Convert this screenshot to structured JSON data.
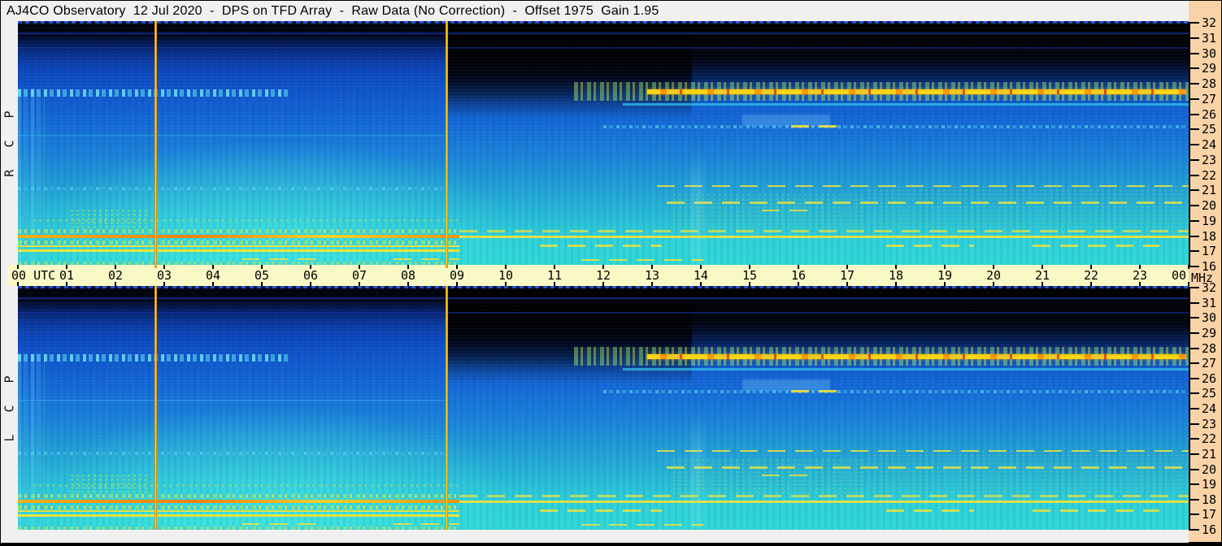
{
  "window": {
    "title": "AJ4CO Observatory  12 Jul 2020  -  DPS on TFD Array  -  Raw Data (No Correction)  -  Offset 1975  Gain 1.95"
  },
  "palette": {
    "titlebar_bg": "#f0f0f0",
    "time_axis_bg": "#f9f9c6",
    "freq_axis_bg": "#f9d3a7",
    "gutter_bg": "#f0f0f0",
    "border": "#000000",
    "calibration_line": "#ffd818",
    "calibration_line_edge": "#c05a08",
    "spectrogram_low": "#000104",
    "spectrogram_mid": "#1464d4",
    "spectrogram_high": "#2fd8da",
    "rfi_line": "#f0e23c",
    "emission_band_core": "#ffd414"
  },
  "chart_data": {
    "type": "heatmap",
    "subtype": "radio-spectrogram-dynamic-spectrum",
    "observatory": "AJ4CO Observatory",
    "date": "12 Jul 2020",
    "instrument": "DPS on TFD Array",
    "processing": "Raw Data (No Correction)",
    "offset": 1975,
    "gain": 1.95,
    "panels": [
      {
        "id": "rcp",
        "label": "R C P"
      },
      {
        "id": "lcp",
        "label": "L C P"
      }
    ],
    "time_axis": {
      "start_label": "00 UTC",
      "hour_labels": [
        "01",
        "02",
        "03",
        "04",
        "05",
        "06",
        "07",
        "08",
        "09",
        "10",
        "11",
        "12",
        "13",
        "14",
        "15",
        "16",
        "17",
        "18",
        "19",
        "20",
        "21",
        "22",
        "23"
      ],
      "end_label": "00",
      "hours_start": 0,
      "hours_end": 24
    },
    "freq_axis": {
      "unit": "MHz",
      "min": 16,
      "max": 32,
      "labels": [
        "32",
        "31",
        "30",
        "29",
        "28",
        "27",
        "26",
        "25",
        "24",
        "23",
        "22",
        "21",
        "20",
        "19",
        "18",
        "17",
        "16"
      ]
    },
    "features": [
      {
        "pattern": "vline",
        "h": 2.82,
        "note": "calibration line"
      },
      {
        "pattern": "vline",
        "h": 8.78,
        "note": "calibration line"
      },
      {
        "pattern": "line-blue-speckle",
        "h0": 0,
        "h1": 24,
        "f0": 31.98,
        "f1": 31.82,
        "opacity": 0.9
      },
      {
        "pattern": "line-blue-faint",
        "h0": 0,
        "h1": 24,
        "f0": 31.25,
        "f1": 31.15,
        "opacity": 0.7
      },
      {
        "pattern": "line-blue-faint",
        "h0": 0,
        "h1": 24,
        "f0": 30.3,
        "f1": 30.2,
        "opacity": 0.5
      },
      {
        "pattern": "speckle-cyan",
        "h0": 0,
        "h1": 0.55,
        "f0": 27.6,
        "f1": 16.1,
        "opacity": 0.28
      },
      {
        "pattern": "speckle-cyan",
        "h0": 0,
        "h1": 5.6,
        "f0": 27.5,
        "f1": 27.05,
        "opacity": 0.85
      },
      {
        "pattern": "speckle-green",
        "h0": 11.4,
        "h1": 24,
        "f0": 28.0,
        "f1": 26.8,
        "opacity": 0.55
      },
      {
        "pattern": "core-orange",
        "h0": 12.9,
        "h1": 23.95,
        "f0": 27.5,
        "f1": 27.2,
        "opacity": 1
      },
      {
        "pattern": "line-cyan",
        "h0": 12.4,
        "h1": 24,
        "f0": 26.6,
        "f1": 26.45,
        "opacity": 0.7
      },
      {
        "pattern": "patch-blue",
        "h0": 14.85,
        "h1": 16.65,
        "f0": 25.85,
        "f1": 25.1,
        "opacity": 0.55
      },
      {
        "pattern": "speckle-cyan",
        "h0": 12,
        "h1": 24,
        "f0": 25.15,
        "f1": 24.95,
        "opacity": 0.55
      },
      {
        "pattern": "dash-yellow",
        "h0": 15.85,
        "h1": 16.95,
        "f0": 25.15,
        "f1": 25.0,
        "opacity": 0.9
      },
      {
        "pattern": "line-cyan",
        "h0": 0,
        "h1": 8.8,
        "f0": 24.55,
        "f1": 24.45,
        "opacity": 0.3
      },
      {
        "pattern": "speckle-cyan",
        "h0": 0,
        "h1": 8.75,
        "f0": 21.1,
        "f1": 20.9,
        "opacity": 0.45
      },
      {
        "pattern": "dash-yellow",
        "h0": 13.1,
        "h1": 24,
        "f0": 21.25,
        "f1": 21.1,
        "opacity": 0.85
      },
      {
        "pattern": "dash-yellow",
        "h0": 13.3,
        "h1": 24,
        "f0": 20.15,
        "f1": 20.0,
        "opacity": 0.8
      },
      {
        "pattern": "dash-yellow",
        "h0": 15.25,
        "h1": 16.35,
        "f0": 19.65,
        "f1": 19.5,
        "opacity": 0.8
      },
      {
        "pattern": "dots-green",
        "h0": 1.05,
        "h1": 2.65,
        "f0": 19.7,
        "f1": 18.3,
        "opacity": 0.85
      },
      {
        "pattern": "dots-green",
        "h0": 13.4,
        "h1": 17.4,
        "f0": 20.7,
        "f1": 18.2,
        "opacity": 0.4
      },
      {
        "pattern": "dots-green",
        "h0": 17.4,
        "h1": 24,
        "f0": 21.3,
        "f1": 17.9,
        "opacity": 0.3
      },
      {
        "pattern": "glow-v",
        "h0": 13.8,
        "h1": 14.05,
        "f0": 23.5,
        "f1": 16.0,
        "opacity": 0.3
      },
      {
        "pattern": "speckle-green",
        "h0": 0.3,
        "h1": 9.05,
        "f0": 19.0,
        "f1": 18.85,
        "opacity": 0.4
      },
      {
        "pattern": "speckle-green",
        "h0": 0,
        "h1": 9.05,
        "f0": 18.35,
        "f1": 18.1,
        "opacity": 0.8
      },
      {
        "pattern": "dash-yellow",
        "h0": 9.05,
        "h1": 24,
        "f0": 18.3,
        "f1": 18.15,
        "opacity": 0.7
      },
      {
        "pattern": "line-yellow-orange",
        "h0": 0,
        "h1": 9.05,
        "f0": 17.95,
        "f1": 17.75,
        "opacity": 1
      },
      {
        "pattern": "line-yellow",
        "h0": 9.05,
        "h1": 24,
        "f0": 17.9,
        "f1": 17.75,
        "opacity": 0.9
      },
      {
        "pattern": "speckle-green",
        "h0": 0,
        "h1": 9.05,
        "f0": 17.6,
        "f1": 17.35,
        "opacity": 0.85
      },
      {
        "pattern": "line-yellow",
        "h0": 0,
        "h1": 9.05,
        "f0": 17.3,
        "f1": 17.15,
        "opacity": 0.95
      },
      {
        "pattern": "dash-yellow",
        "h0": 10.7,
        "h1": 13.2,
        "f0": 17.35,
        "f1": 17.2,
        "opacity": 0.8
      },
      {
        "pattern": "dash-yellow",
        "h0": 17.8,
        "h1": 19.6,
        "f0": 17.35,
        "f1": 17.2,
        "opacity": 0.8
      },
      {
        "pattern": "dash-yellow",
        "h0": 20.8,
        "h1": 23.4,
        "f0": 17.35,
        "f1": 17.2,
        "opacity": 0.8
      },
      {
        "pattern": "line-yellow",
        "h0": 0,
        "h1": 9.05,
        "f0": 17.0,
        "f1": 16.85,
        "opacity": 1
      },
      {
        "pattern": "dash-yellow",
        "h0": 4.6,
        "h1": 6.3,
        "f0": 16.45,
        "f1": 16.3,
        "opacity": 0.85
      },
      {
        "pattern": "dash-yellow",
        "h0": 7.7,
        "h1": 9.05,
        "f0": 16.45,
        "f1": 16.3,
        "opacity": 0.85
      },
      {
        "pattern": "dash-yellow",
        "h0": 11.55,
        "h1": 14.05,
        "f0": 16.4,
        "f1": 16.25,
        "opacity": 0.85
      },
      {
        "pattern": "speckle-green",
        "h0": 0,
        "h1": 9.05,
        "f0": 16.2,
        "f1": 16.0,
        "opacity": 0.7
      }
    ]
  }
}
